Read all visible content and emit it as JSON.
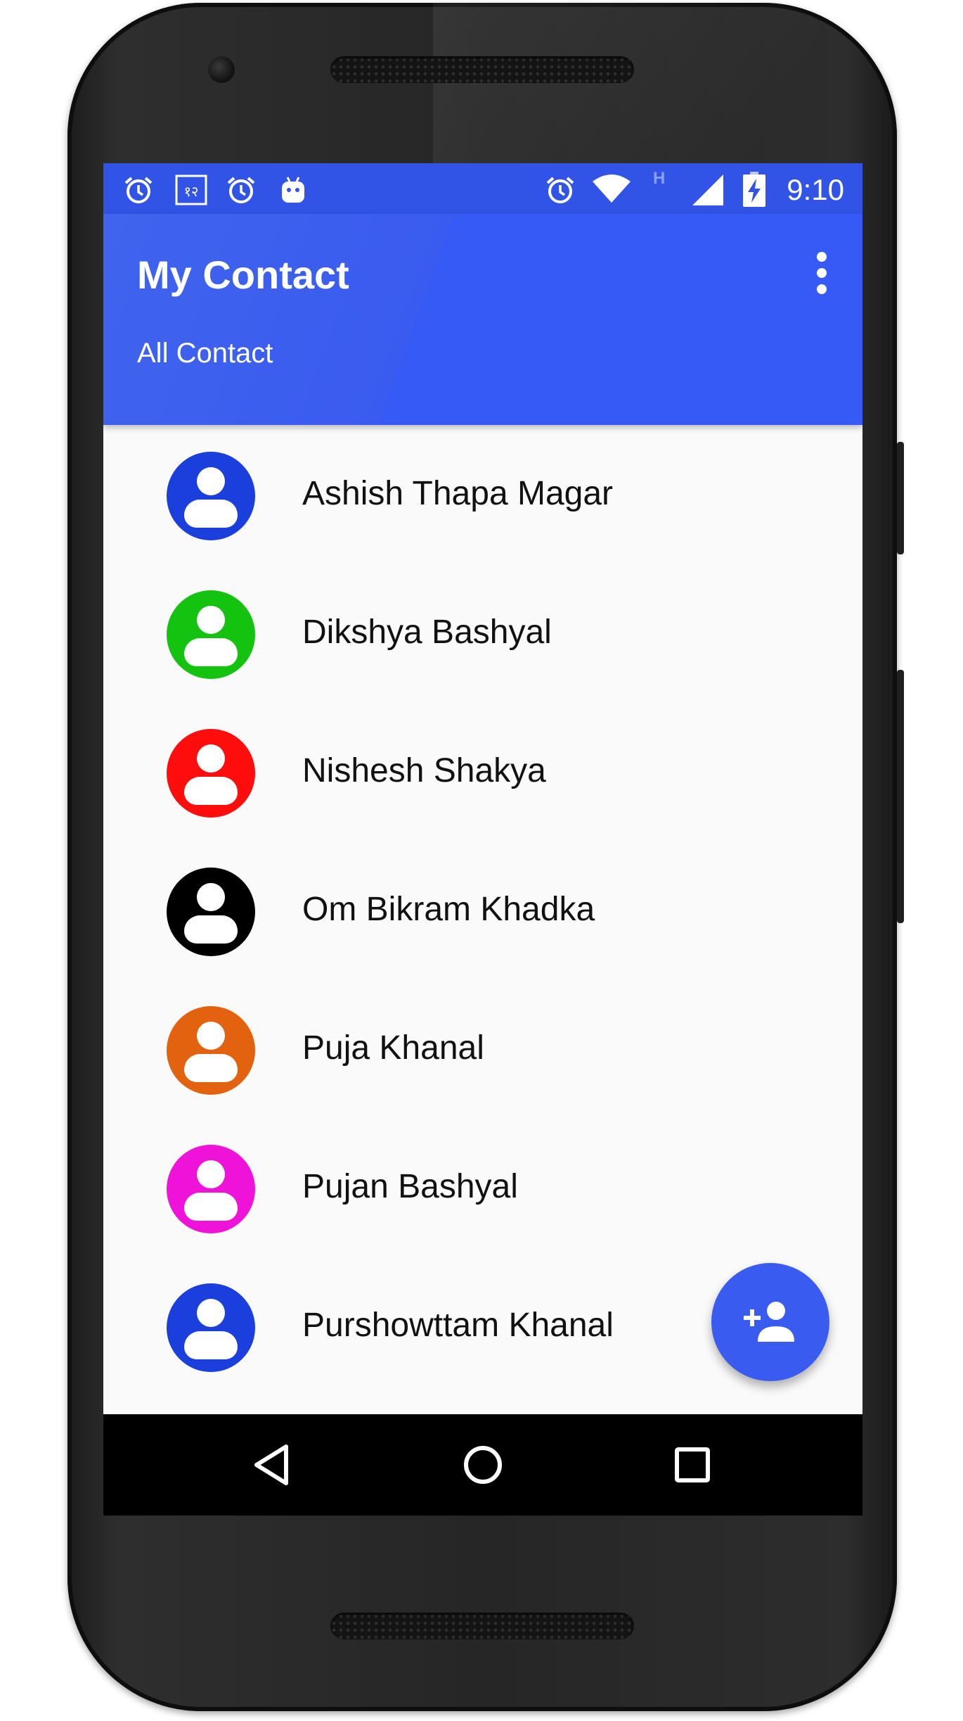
{
  "status_bar": {
    "time": "9:10",
    "network_indicator": "H",
    "left_icons": [
      "alarm-icon",
      "keyboard-language-icon",
      "alarm-icon",
      "android-debug-icon"
    ],
    "right_icons": [
      "alarm-icon",
      "wifi-icon",
      "cellular-signal-icon",
      "battery-charging-icon"
    ]
  },
  "app_bar": {
    "title": "My Contact",
    "subtitle": "All Contact",
    "overflow_icon": "more-vert-icon",
    "color": "#355af5"
  },
  "contacts": [
    {
      "name": "Ashish Thapa Magar",
      "avatar_color": "#1a3fdd"
    },
    {
      "name": "Dikshya Bashyal",
      "avatar_color": "#13c30f"
    },
    {
      "name": "Nishesh Shakya",
      "avatar_color": "#ff0d0d"
    },
    {
      "name": "Om Bikram Khadka",
      "avatar_color": "#000000"
    },
    {
      "name": "Puja Khanal",
      "avatar_color": "#e2620f"
    },
    {
      "name": "Pujan Bashyal",
      "avatar_color": "#ef12d9"
    },
    {
      "name": "Purshowttam Khanal",
      "avatar_color": "#1a3fdd"
    }
  ],
  "fab": {
    "icon": "add-person-icon"
  },
  "nav_bar": {
    "icons": [
      "back-icon",
      "home-icon",
      "recents-icon"
    ]
  }
}
